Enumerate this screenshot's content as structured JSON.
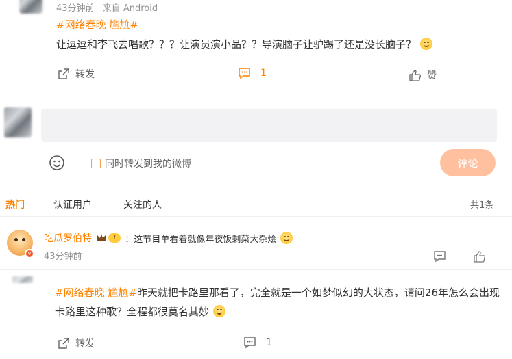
{
  "post": {
    "meta_time": "43分钟前",
    "meta_source": "来自 Android",
    "hashtag": "#网络春晚 尴尬#",
    "text": "让逗逗和李飞去唱歌？？？让演员演小品？？导演脑子让驴踢了还是没长脑子？",
    "actions": {
      "repost_label": "转发",
      "comment_count": "1",
      "like_label": "赞"
    }
  },
  "composer": {
    "input_placeholder": "",
    "forward_checkbox_label": "同时转发到我的微博",
    "submit_label": "评论"
  },
  "comments_tabs": {
    "tabs": [
      "热门",
      "认证用户",
      "关注的人"
    ],
    "total": "共1条"
  },
  "comment": {
    "username": "吃瓜罗伯特",
    "badge_level": "1",
    "text": "：这节目单看着就像年夜饭剩菜大杂烩",
    "time": "43分钟前"
  },
  "post2": {
    "hashtag": "#网络春晚 尴尬#",
    "text": "昨天就把卡路里那看了，完全就是一个如梦似幻的大状态，请问26年怎么会出现卡路里这种歌？全程都很莫名其妙",
    "actions": {
      "repost_label": "转发",
      "comment_count": "1"
    }
  },
  "colors": {
    "accent": "#ff8200",
    "submit_bg": "#ffc09f",
    "text_gray": "#939393",
    "input_bg": "#f2f2f5"
  }
}
